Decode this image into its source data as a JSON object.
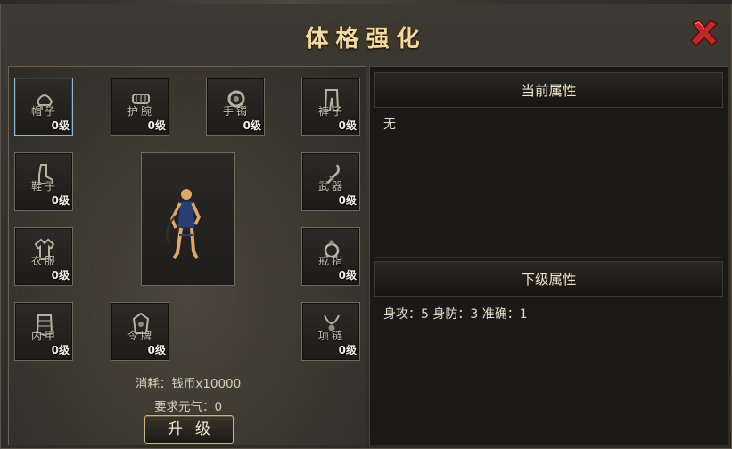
{
  "window": {
    "title": "体格强化"
  },
  "slots": [
    {
      "name": "帽子",
      "level": "0级"
    },
    {
      "name": "护腕",
      "level": "0级"
    },
    {
      "name": "手镯",
      "level": "0级"
    },
    {
      "name": "裤子",
      "level": "0级"
    },
    {
      "name": "鞋子",
      "level": "0级"
    },
    {
      "name": "武器",
      "level": "0级"
    },
    {
      "name": "衣服",
      "level": "0级"
    },
    {
      "name": "戒指",
      "level": "0级"
    },
    {
      "name": "内甲",
      "level": "0级"
    },
    {
      "name": "令牌",
      "level": "0级"
    },
    {
      "name": "项链",
      "level": "0级"
    }
  ],
  "cost": {
    "line1": "消耗：钱币x10000",
    "line2": "要求元气：0"
  },
  "upgrade_button": "升级",
  "current_attrs": {
    "header": "当前属性",
    "value": "无"
  },
  "next_attrs": {
    "header": "下级属性",
    "value": "身攻：5 身防：3 准确：1"
  },
  "colors": {
    "title": "#f3d9a4",
    "selected_border": "#8fb8d8",
    "close": "#c0282a"
  }
}
